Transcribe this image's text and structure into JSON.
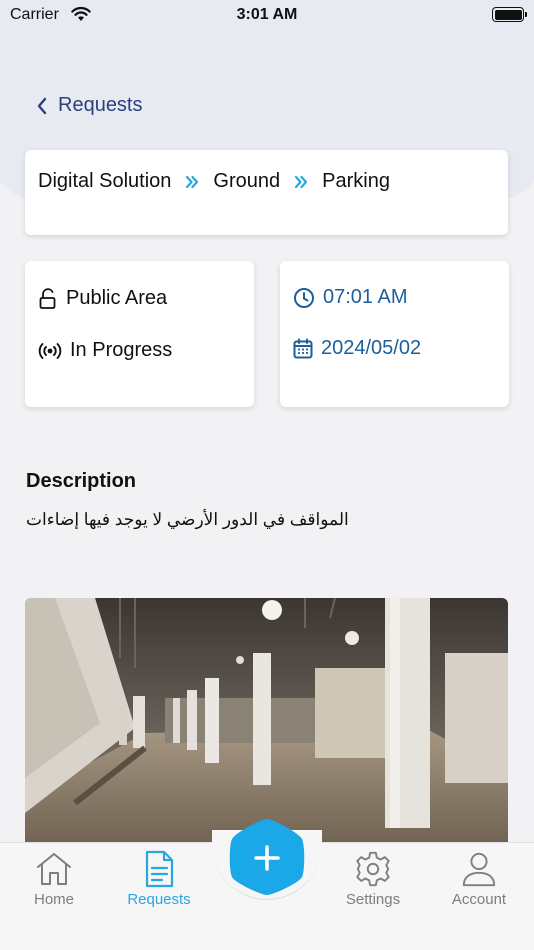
{
  "status_bar": {
    "carrier": "Carrier",
    "time": "3:01 AM"
  },
  "nav": {
    "back_label": "Requests"
  },
  "breadcrumb": [
    "Digital Solution",
    "Ground",
    "Parking"
  ],
  "info": {
    "area": "Public Area",
    "status": "In Progress",
    "time": "07:01 AM",
    "date": "2024/05/02"
  },
  "description": {
    "title": "Description",
    "text": "المواقف في الدور الأرضي لا يوجد فيها إضاءات"
  },
  "tabs": [
    {
      "label": "Home",
      "icon": "home-icon"
    },
    {
      "label": "Requests",
      "icon": "document-icon",
      "active": true
    },
    {
      "label": "Settings",
      "icon": "gear-icon"
    },
    {
      "label": "Account",
      "icon": "user-icon"
    }
  ],
  "colors": {
    "accent": "#27a7e0",
    "nav": "#2b3f7f",
    "info": "#1e5f9b"
  }
}
